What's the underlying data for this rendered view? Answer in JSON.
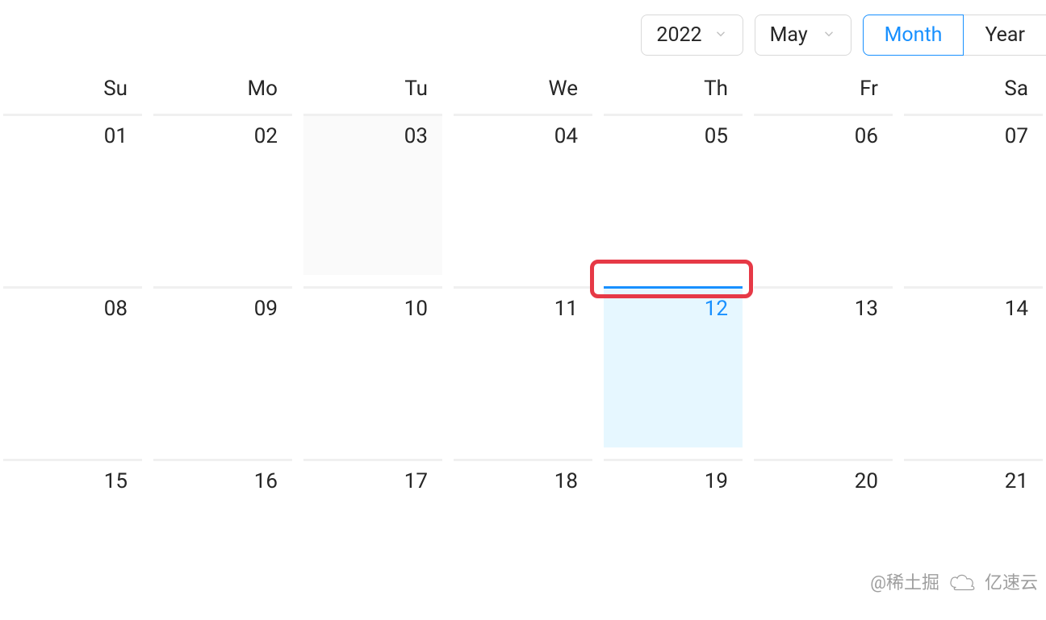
{
  "header": {
    "year": "2022",
    "month": "May",
    "view_month": "Month",
    "view_year": "Year"
  },
  "weekdays": [
    "Su",
    "Mo",
    "Tu",
    "We",
    "Th",
    "Fr",
    "Sa"
  ],
  "days": [
    {
      "num": "01",
      "today": false,
      "hovered": false
    },
    {
      "num": "02",
      "today": false,
      "hovered": false
    },
    {
      "num": "03",
      "today": false,
      "hovered": true
    },
    {
      "num": "04",
      "today": false,
      "hovered": false
    },
    {
      "num": "05",
      "today": false,
      "hovered": false
    },
    {
      "num": "06",
      "today": false,
      "hovered": false
    },
    {
      "num": "07",
      "today": false,
      "hovered": false
    },
    {
      "num": "08",
      "today": false,
      "hovered": false
    },
    {
      "num": "09",
      "today": false,
      "hovered": false
    },
    {
      "num": "10",
      "today": false,
      "hovered": false
    },
    {
      "num": "11",
      "today": false,
      "hovered": false
    },
    {
      "num": "12",
      "today": true,
      "hovered": false
    },
    {
      "num": "13",
      "today": false,
      "hovered": false
    },
    {
      "num": "14",
      "today": false,
      "hovered": false
    },
    {
      "num": "15",
      "today": false,
      "hovered": false
    },
    {
      "num": "16",
      "today": false,
      "hovered": false
    },
    {
      "num": "17",
      "today": false,
      "hovered": false
    },
    {
      "num": "18",
      "today": false,
      "hovered": false
    },
    {
      "num": "19",
      "today": false,
      "hovered": false
    },
    {
      "num": "20",
      "today": false,
      "hovered": false
    },
    {
      "num": "21",
      "today": false,
      "hovered": false
    }
  ],
  "watermark": {
    "text1": "@稀土掘",
    "text2": "亿速云"
  }
}
